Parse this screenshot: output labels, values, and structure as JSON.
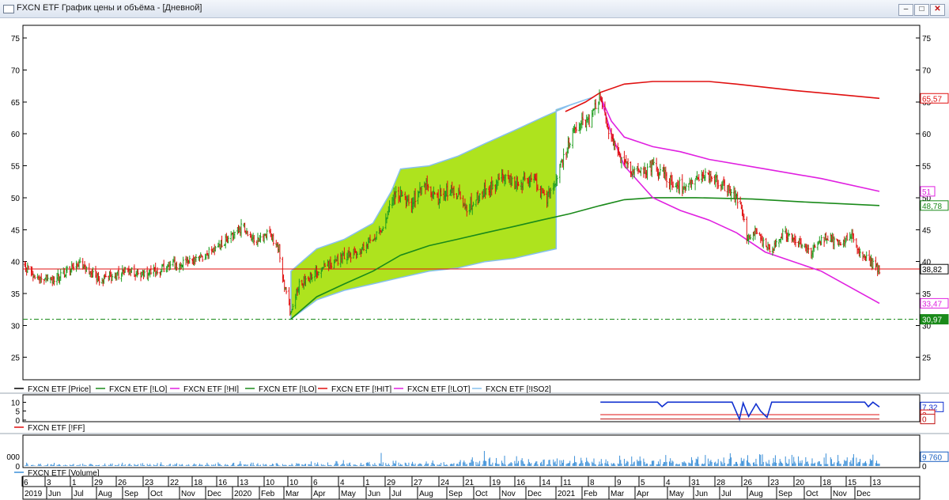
{
  "window": {
    "title": "FXCN ETF График цены и объёма - [Дневной]",
    "buttons": {
      "minimize": "–",
      "restore": "□",
      "close": "✕"
    },
    "icon": "chart-window-icon"
  },
  "colors": {
    "price_up": "#1f9d1f",
    "price_down": "#e01010",
    "channel_fill": "#aee31e",
    "channel_edge": "#87c0ee",
    "lo_line": "#1a8a1a",
    "hit_line": "#e01010",
    "hi_line": "#e020e0",
    "support_line": "#1a8a1a",
    "ff_line": "#1030d0",
    "volume": "#3a8fd8"
  },
  "chart_data": [
    {
      "type": "line",
      "name": "price-panel",
      "y_ticks": [
        25,
        30,
        35,
        40,
        45,
        50,
        55,
        60,
        65,
        70,
        75
      ],
      "ylim": [
        21.5,
        77
      ],
      "xlim": [
        "2019-06-01",
        "2021-12-17"
      ],
      "legend": [
        "FXCN ETF [Price]",
        "FXCN ETF [!LO]",
        "FXCN ETF [!HI]",
        "FXCN ETF [!LO]",
        "FXCN ETF [!HIT]",
        "FXCN ETF [!LOT]",
        "FXCN ETF [!ISO2]"
      ],
      "legend_colors": [
        "#000000",
        "#1a8a1a",
        "#e020e0",
        "#1a8a1a",
        "#e01010",
        "#e020e0",
        "#87c0ee"
      ],
      "value_labels": [
        {
          "text": "65,57",
          "value": 65.57,
          "color": "#e01010",
          "bg": "#ffffff"
        },
        {
          "text": "51",
          "value": 51.0,
          "color": "#e020e0",
          "bg": "#ffffff"
        },
        {
          "text": "48,78",
          "value": 48.78,
          "color": "#1a8a1a",
          "bg": "#ffffff"
        },
        {
          "text": "38,82",
          "value": 38.82,
          "color": "#000000",
          "bg": "#ffffff"
        },
        {
          "text": "33,47",
          "value": 33.47,
          "color": "#e020e0",
          "bg": "#ffffff"
        },
        {
          "text": "30,97",
          "value": 30.97,
          "color": "#ffffff",
          "bg": "#1a8a1a"
        }
      ],
      "horizontal_lines": [
        {
          "value": 38.82,
          "color": "#e01010",
          "style": "solid"
        },
        {
          "value": 30.97,
          "color": "#1a8a1a",
          "style": "dashdot"
        }
      ],
      "price_anchors": [
        [
          "2019-06-01",
          39.5
        ],
        [
          "2019-06-20",
          37.2
        ],
        [
          "2019-07-10",
          37.5
        ],
        [
          "2019-08-01",
          40.0
        ],
        [
          "2019-08-25",
          37.0
        ],
        [
          "2019-09-20",
          38.5
        ],
        [
          "2019-10-15",
          38.0
        ],
        [
          "2019-11-10",
          39.5
        ],
        [
          "2019-12-10",
          40.5
        ],
        [
          "2020-01-10",
          43.5
        ],
        [
          "2020-01-25",
          45.5
        ],
        [
          "2020-02-10",
          43.0
        ],
        [
          "2020-02-22",
          44.5
        ],
        [
          "2020-03-05",
          42.0
        ],
        [
          "2020-03-10",
          37.0
        ],
        [
          "2020-03-18",
          31.5
        ],
        [
          "2020-03-25",
          36.0
        ],
        [
          "2020-04-15",
          38.5
        ],
        [
          "2020-05-10",
          40.5
        ],
        [
          "2020-06-05",
          42.0
        ],
        [
          "2020-06-25",
          45.0
        ],
        [
          "2020-07-10",
          51.0
        ],
        [
          "2020-07-25",
          49.0
        ],
        [
          "2020-08-10",
          52.0
        ],
        [
          "2020-08-25",
          50.0
        ],
        [
          "2020-09-10",
          51.5
        ],
        [
          "2020-09-25",
          48.5
        ],
        [
          "2020-10-15",
          51.0
        ],
        [
          "2020-11-05",
          53.5
        ],
        [
          "2020-11-20",
          52.0
        ],
        [
          "2020-12-05",
          53.5
        ],
        [
          "2020-12-20",
          49.5
        ],
        [
          "2021-01-05",
          55.0
        ],
        [
          "2021-01-20",
          61.0
        ],
        [
          "2021-02-05",
          62.0
        ],
        [
          "2021-02-17",
          65.8
        ],
        [
          "2021-02-25",
          61.0
        ],
        [
          "2021-03-10",
          56.5
        ],
        [
          "2021-03-25",
          54.0
        ],
        [
          "2021-04-15",
          55.0
        ],
        [
          "2021-05-05",
          52.5
        ],
        [
          "2021-05-20",
          51.5
        ],
        [
          "2021-06-10",
          53.5
        ],
        [
          "2021-06-25",
          52.5
        ],
        [
          "2021-07-10",
          50.5
        ],
        [
          "2021-07-20",
          49.0
        ],
        [
          "2021-07-26",
          43.5
        ],
        [
          "2021-08-05",
          45.0
        ],
        [
          "2021-08-20",
          41.5
        ],
        [
          "2021-09-05",
          44.5
        ],
        [
          "2021-09-20",
          43.0
        ],
        [
          "2021-10-05",
          41.5
        ],
        [
          "2021-10-20",
          44.0
        ],
        [
          "2021-11-05",
          42.5
        ],
        [
          "2021-11-15",
          44.5
        ],
        [
          "2021-11-25",
          42.0
        ],
        [
          "2021-12-05",
          40.0
        ],
        [
          "2021-12-17",
          38.8
        ]
      ],
      "channel_upper": [
        [
          "2020-03-18",
          38.5
        ],
        [
          "2020-04-15",
          42.0
        ],
        [
          "2020-05-15",
          43.5
        ],
        [
          "2020-06-15",
          46.0
        ],
        [
          "2020-07-05",
          51.0
        ],
        [
          "2020-07-15",
          54.5
        ],
        [
          "2020-08-15",
          55.0
        ],
        [
          "2020-09-15",
          56.5
        ],
        [
          "2020-10-15",
          58.5
        ],
        [
          "2020-11-15",
          60.5
        ],
        [
          "2020-12-15",
          62.5
        ],
        [
          "2021-01-15",
          64.5
        ],
        [
          "2021-02-10",
          65.8
        ]
      ],
      "channel_lower": [
        [
          "2020-03-18",
          31.0
        ],
        [
          "2020-04-15",
          34.0
        ],
        [
          "2020-05-15",
          35.5
        ],
        [
          "2020-06-15",
          36.5
        ],
        [
          "2020-07-15",
          37.5
        ],
        [
          "2020-08-15",
          38.5
        ],
        [
          "2020-09-15",
          39.0
        ],
        [
          "2020-10-15",
          40.0
        ],
        [
          "2020-11-15",
          40.5
        ],
        [
          "2020-12-15",
          41.5
        ],
        [
          "2020-12-31",
          42.0
        ]
      ],
      "lo_line": [
        [
          "2020-03-18",
          31.0
        ],
        [
          "2020-04-15",
          34.5
        ],
        [
          "2020-05-15",
          36.5
        ],
        [
          "2020-06-15",
          38.5
        ],
        [
          "2020-07-15",
          41.0
        ],
        [
          "2020-08-15",
          42.5
        ],
        [
          "2020-09-15",
          43.5
        ],
        [
          "2020-10-15",
          44.5
        ],
        [
          "2020-11-15",
          45.5
        ],
        [
          "2020-12-15",
          46.5
        ],
        [
          "2021-01-15",
          47.5
        ],
        [
          "2021-02-15",
          48.7
        ],
        [
          "2021-03-15",
          49.7
        ],
        [
          "2021-04-15",
          50.0
        ],
        [
          "2021-06-01",
          50.0
        ],
        [
          "2021-08-01",
          49.8
        ],
        [
          "2021-10-01",
          49.3
        ],
        [
          "2021-12-17",
          48.78
        ]
      ],
      "hit_line": [
        [
          "2021-01-10",
          63.5
        ],
        [
          "2021-02-01",
          65.0
        ],
        [
          "2021-02-17",
          66.5
        ],
        [
          "2021-03-15",
          67.8
        ],
        [
          "2021-04-15",
          68.2
        ],
        [
          "2021-06-15",
          68.2
        ],
        [
          "2021-07-15",
          67.8
        ],
        [
          "2021-09-15",
          66.8
        ],
        [
          "2021-11-15",
          66.0
        ],
        [
          "2021-12-17",
          65.57
        ]
      ],
      "hi_line": [
        [
          "2021-02-17",
          65.8
        ],
        [
          "2021-03-01",
          62.0
        ],
        [
          "2021-03-15",
          59.5
        ],
        [
          "2021-04-15",
          58.0
        ],
        [
          "2021-05-15",
          57.2
        ],
        [
          "2021-06-15",
          56.0
        ],
        [
          "2021-08-15",
          54.5
        ],
        [
          "2021-10-15",
          53.0
        ],
        [
          "2021-12-17",
          51.0
        ]
      ],
      "lot_line": [
        [
          "2021-02-17",
          65.8
        ],
        [
          "2021-03-01",
          60.0
        ],
        [
          "2021-03-15",
          55.0
        ],
        [
          "2021-04-15",
          50.0
        ],
        [
          "2021-05-15",
          48.0
        ],
        [
          "2021-06-15",
          46.5
        ],
        [
          "2021-07-15",
          44.5
        ],
        [
          "2021-08-15",
          41.5
        ],
        [
          "2021-10-15",
          38.5
        ],
        [
          "2021-12-17",
          33.47
        ]
      ]
    },
    {
      "type": "line",
      "name": "ff-panel",
      "y_ticks": [
        0,
        5,
        10
      ],
      "ylim": [
        0,
        11
      ],
      "legend": [
        "FXCN ETF [!FF]"
      ],
      "legend_colors": [
        "#e01010"
      ],
      "value_labels": [
        {
          "text": "7,32",
          "value": 7.32,
          "color": "#1030d0",
          "bg": "#ffffff"
        },
        {
          "text": "3",
          "value": 3.0,
          "color": "#e01010",
          "bg": "#ffffff"
        },
        {
          "text": "0",
          "value": 0.6,
          "color": "#c01010",
          "bg": "#ffffff"
        }
      ],
      "series": [
        {
          "name": "FF",
          "x": [
            "2021-02-17",
            "2021-04-20",
            "2021-04-25",
            "2021-05-01",
            "2021-07-10",
            "2021-07-18",
            "2021-07-22",
            "2021-07-28",
            "2021-08-05",
            "2021-08-10",
            "2021-08-17",
            "2021-08-22",
            "2021-12-01",
            "2021-12-05",
            "2021-12-10",
            "2021-12-17"
          ],
          "values": [
            10.0,
            10.0,
            7.5,
            10.0,
            10.0,
            0.5,
            9.5,
            2.0,
            9.0,
            5.0,
            1.5,
            10.0,
            10.0,
            7.5,
            10.0,
            7.32
          ]
        }
      ],
      "threshold_lines": [
        {
          "value": 3.0,
          "color": "#e01010"
        },
        {
          "value": 0.6,
          "color": "#c01010"
        }
      ]
    },
    {
      "type": "bar",
      "name": "volume-panel",
      "y_ticks": [
        0
      ],
      "ylim": [
        0,
        30000
      ],
      "legend": [
        "FXCN ETF [Volume]"
      ],
      "legend_colors": [
        "#3a8fd8"
      ],
      "value_labels": [
        {
          "text": "9 760",
          "value": 9760,
          "color": "#1a5fc0",
          "bg": "#ffffff"
        }
      ],
      "axis_labels": [
        {
          "text": "000",
          "value": 10000
        },
        {
          "text": "0",
          "value": 0
        }
      ],
      "volume_regimes": [
        [
          "2019-06-01",
          1800
        ],
        [
          "2020-03-10",
          2600
        ],
        [
          "2020-09-01",
          4000
        ],
        [
          "2020-10-20",
          6500
        ],
        [
          "2021-02-10",
          6500
        ],
        [
          "2021-07-01",
          8000
        ],
        [
          "2021-12-17",
          9760
        ]
      ]
    }
  ],
  "timeline": {
    "top": [
      "6",
      "3",
      "1",
      "29",
      "26",
      "23",
      "22",
      "18",
      "16",
      "13",
      "10",
      "10",
      "6",
      "4",
      "1",
      "29",
      "27",
      "24",
      "21",
      "19",
      "16",
      "14",
      "11",
      "8",
      "9",
      "5",
      "4",
      "31",
      "28",
      "26",
      "23",
      "20",
      "18",
      "15",
      "13"
    ],
    "bottom": [
      "2019",
      "Jun",
      "Jul",
      "Aug",
      "Sep",
      "Oct",
      "Nov",
      "Dec",
      "2020",
      "Feb",
      "Mar",
      "Apr",
      "May",
      "Jun",
      "Jul",
      "Aug",
      "Sep",
      "Oct",
      "Nov",
      "Dec",
      "2021",
      "Feb",
      "Mar",
      "Apr",
      "May",
      "Jun",
      "Jul",
      "Aug",
      "Sep",
      "Oct",
      "Nov",
      "Dec"
    ]
  }
}
